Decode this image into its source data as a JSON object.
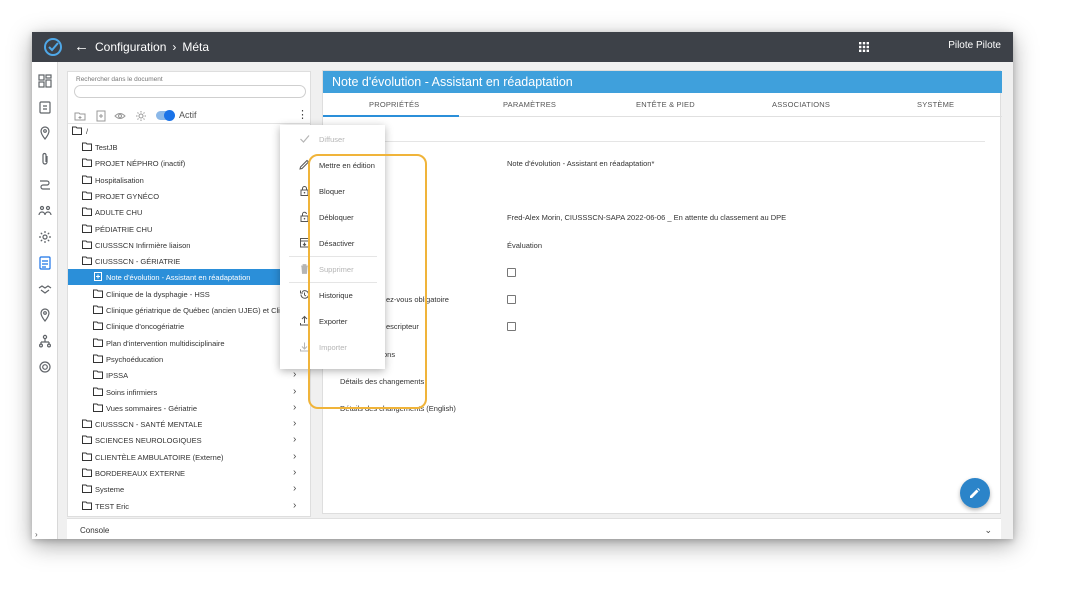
{
  "topbar": {
    "back_glyph": "←",
    "crumb1": "Configuration",
    "crumb_sep": "›",
    "crumb2": "Méta",
    "user": "Pilote Pilote"
  },
  "tree_panel": {
    "search_label": "Rechercher dans le document",
    "search_value": "",
    "toggle_label": "Actif",
    "root_label": "/",
    "items": [
      {
        "label": "TestJB",
        "level": 1,
        "icon": "folder-icon",
        "chevron": false
      },
      {
        "label": "PROJET NÉPHRO (inactif)",
        "level": 1,
        "icon": "folder-icon",
        "chevron": false
      },
      {
        "label": "Hospitalisation",
        "level": 1,
        "icon": "folder-icon",
        "chevron": false
      },
      {
        "label": "PROJET GYNÉCO",
        "level": 1,
        "icon": "folder-icon",
        "chevron": false
      },
      {
        "label": "ADULTE CHU",
        "level": 1,
        "icon": "folder-icon",
        "chevron": false
      },
      {
        "label": "PÉDIATRIE CHU",
        "level": 1,
        "icon": "folder-icon",
        "chevron": false
      },
      {
        "label": "CIUSSSCN Infirmière liaison",
        "level": 1,
        "icon": "folder-icon",
        "chevron": false
      },
      {
        "label": "CIUSSSCN - GÉRIATRIE",
        "level": 1,
        "icon": "folder-icon",
        "chevron": false
      },
      {
        "label": "Note d'évolution - Assistant en réadaptation",
        "level": 2,
        "icon": "document-icon",
        "chevron": false,
        "selected": true
      },
      {
        "label": "Clinique de la dysphagie - HSS",
        "level": 2,
        "icon": "folder-icon",
        "chevron": false
      },
      {
        "label": "Clinique gériatrique de Québec (ancien UJEG) et Clin...",
        "level": 2,
        "icon": "folder-icon",
        "chevron": false
      },
      {
        "label": "Clinique d'oncogériatrie",
        "level": 2,
        "icon": "folder-icon",
        "chevron": false
      },
      {
        "label": "Plan d'intervention multidisciplinaire",
        "level": 2,
        "icon": "folder-icon",
        "chevron": false
      },
      {
        "label": "Psychoéducation",
        "level": 2,
        "icon": "folder-icon",
        "chevron": false
      },
      {
        "label": "IPSSA",
        "level": 2,
        "icon": "folder-icon",
        "chevron": true
      },
      {
        "label": "Soins infirmiers",
        "level": 2,
        "icon": "folder-icon",
        "chevron": true
      },
      {
        "label": "Vues sommaires - Gériatrie",
        "level": 2,
        "icon": "folder-icon",
        "chevron": true
      },
      {
        "label": "CIUSSSCN - SANTÉ MENTALE",
        "level": 1,
        "icon": "folder-icon",
        "chevron": true
      },
      {
        "label": "SCIENCES NEUROLOGIQUES",
        "level": 1,
        "icon": "folder-icon",
        "chevron": true
      },
      {
        "label": "CLIENTÈLE AMBULATOIRE (Externe)",
        "level": 1,
        "icon": "folder-icon",
        "chevron": true
      },
      {
        "label": "BORDEREAUX EXTERNE",
        "level": 1,
        "icon": "folder-icon",
        "chevron": true
      },
      {
        "label": "Systeme",
        "level": 1,
        "icon": "folder-icon",
        "chevron": true
      },
      {
        "label": "TEST Eric",
        "level": 1,
        "icon": "folder-icon",
        "chevron": true
      }
    ]
  },
  "context_menu": {
    "items": [
      {
        "label": "Diffuser",
        "icon": "check-icon",
        "disabled": true
      },
      {
        "label": "Mettre en édition",
        "icon": "pencil-icon",
        "disabled": false
      },
      {
        "label": "Bloquer",
        "icon": "lock-icon",
        "disabled": false
      },
      {
        "label": "Débloquer",
        "icon": "unlock-icon",
        "disabled": false
      },
      {
        "label": "Désactiver",
        "icon": "archive-icon",
        "disabled": false
      },
      {
        "label": "Supprimer",
        "icon": "trash-icon",
        "disabled": true
      },
      {
        "label": "Historique",
        "icon": "history-icon",
        "disabled": false
      },
      {
        "label": "Exporter",
        "icon": "upload-icon",
        "disabled": false
      },
      {
        "label": "Importer",
        "icon": "download-icon",
        "disabled": true
      }
    ]
  },
  "main": {
    "title": "Note d'évolution - Assistant en réadaptation",
    "tabs": [
      {
        "label": "PROPRIÉTÉS",
        "active": true
      },
      {
        "label": "PARAMÈTRES",
        "active": false
      },
      {
        "label": "ENTÊTE & PIED",
        "active": false
      },
      {
        "label": "ASSOCIATIONS",
        "active": false
      },
      {
        "label": "SYSTÈME",
        "active": false
      }
    ],
    "fields": {
      "name_value": "Note d'évolution - Assistant en réadaptation*",
      "name_label_partial": "n",
      "author_value": "Fred-Alex Morin, CIUSSSCN-SAPA 2022-06-06 _ En attente du classement au DPE",
      "type_value": "Évaluation",
      "rdv_label_partial": "ez-vous obligatoire",
      "descripteur_label_partial": "escripteur",
      "version_label_partial": "ons",
      "changes_label": "Détails des changements",
      "changes_en_label": "Détails des changements (English)"
    }
  },
  "console": {
    "label": "Console",
    "chevron": "⌄"
  },
  "colors": {
    "topbar": "#3d4148",
    "accent": "#2b8fd9",
    "header": "#3fa0dc",
    "highlight": "#f0b43a"
  }
}
